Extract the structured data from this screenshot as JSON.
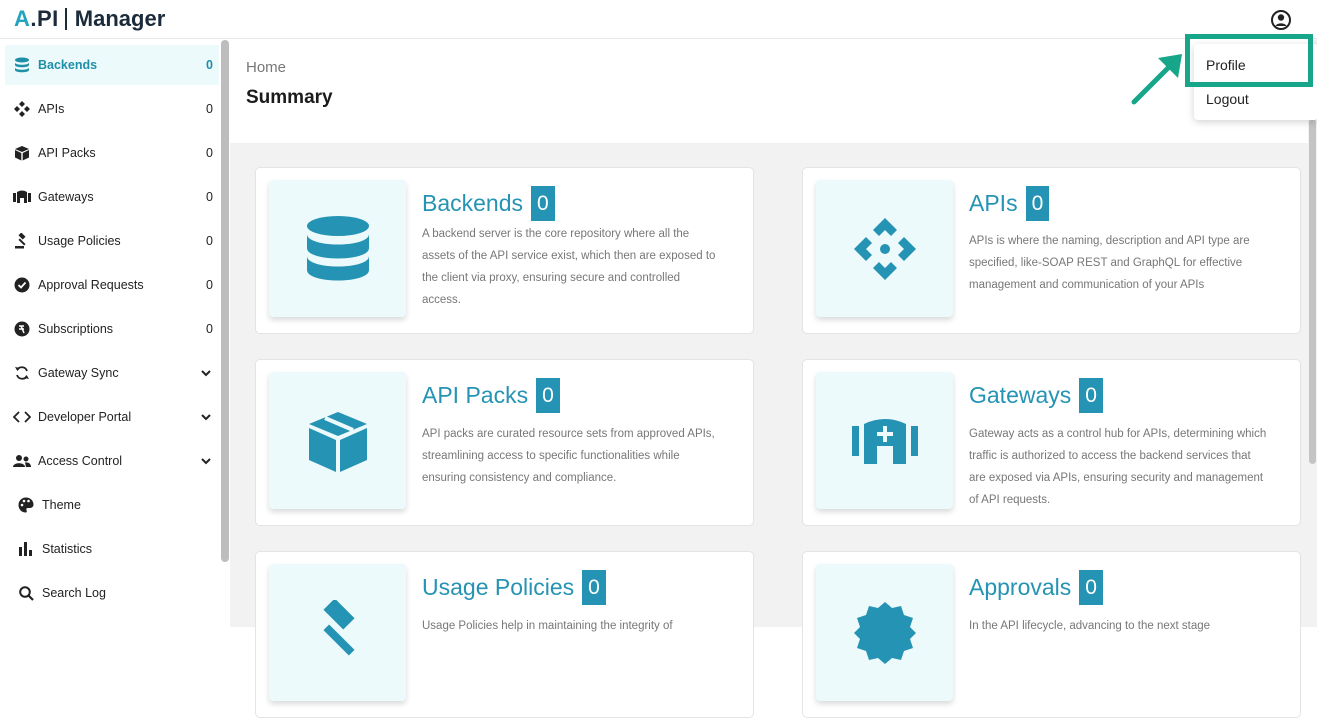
{
  "app": {
    "logo_api": "API",
    "logo_manager": "Manager"
  },
  "sidebar": {
    "items": [
      {
        "label": "Backends",
        "count": "0",
        "icon": "database-icon",
        "active": true
      },
      {
        "label": "APIs",
        "count": "0",
        "icon": "api-icon"
      },
      {
        "label": "API Packs",
        "count": "0",
        "icon": "box-icon"
      },
      {
        "label": "Gateways",
        "count": "0",
        "icon": "gateway-icon"
      },
      {
        "label": "Usage Policies",
        "count": "0",
        "icon": "gavel-icon"
      },
      {
        "label": "Approval Requests",
        "count": "0",
        "icon": "check-badge-icon"
      },
      {
        "label": "Subscriptions",
        "count": "0",
        "icon": "coin-icon"
      },
      {
        "label": "Gateway Sync",
        "icon": "sync-icon",
        "expandable": true
      },
      {
        "label": "Developer Portal",
        "icon": "code-icon",
        "expandable": true
      },
      {
        "label": "Access Control",
        "icon": "users-icon",
        "expandable": true
      },
      {
        "label": "Theme",
        "icon": "palette-icon"
      },
      {
        "label": "Statistics",
        "icon": "bar-chart-icon"
      },
      {
        "label": "Search Log",
        "icon": "search-icon"
      }
    ]
  },
  "header": {
    "breadcrumb": "Home",
    "title": "Summary"
  },
  "cards": [
    {
      "title": "Backends",
      "count": "0",
      "icon": "database-icon",
      "description": "A backend server is the core repository where all the assets of the API service exist, which then are exposed to the client via proxy, ensuring secure and controlled access."
    },
    {
      "title": "APIs",
      "count": "0",
      "icon": "api-icon",
      "description": "APIs is where the naming, description and API type are specified, like-SOAP REST and GraphQL for effective management and communication of your APIs"
    },
    {
      "title": "API Packs",
      "count": "0",
      "icon": "box-icon",
      "description": "API packs are curated resource sets from approved APIs, streamlining access to specific functionalities while ensuring consistency and compliance."
    },
    {
      "title": "Gateways",
      "count": "0",
      "icon": "gateway-icon",
      "description": "Gateway acts as a control hub for APIs, determining which traffic is authorized to access the backend services that are exposed via APIs, ensuring security and management of API requests."
    },
    {
      "title": "Usage Policies",
      "count": "0",
      "icon": "gavel-icon",
      "description": "Usage Policies help in maintaining the integrity of"
    },
    {
      "title": "Approvals",
      "count": "0",
      "icon": "check-badge-icon",
      "description": "In the API lifecycle, advancing to the next stage"
    }
  ],
  "user_menu": {
    "profile": "Profile",
    "logout": "Logout"
  },
  "colors": {
    "accent": "#2593b3",
    "highlight": "#17a68a",
    "active_bg": "#ecfafc"
  }
}
